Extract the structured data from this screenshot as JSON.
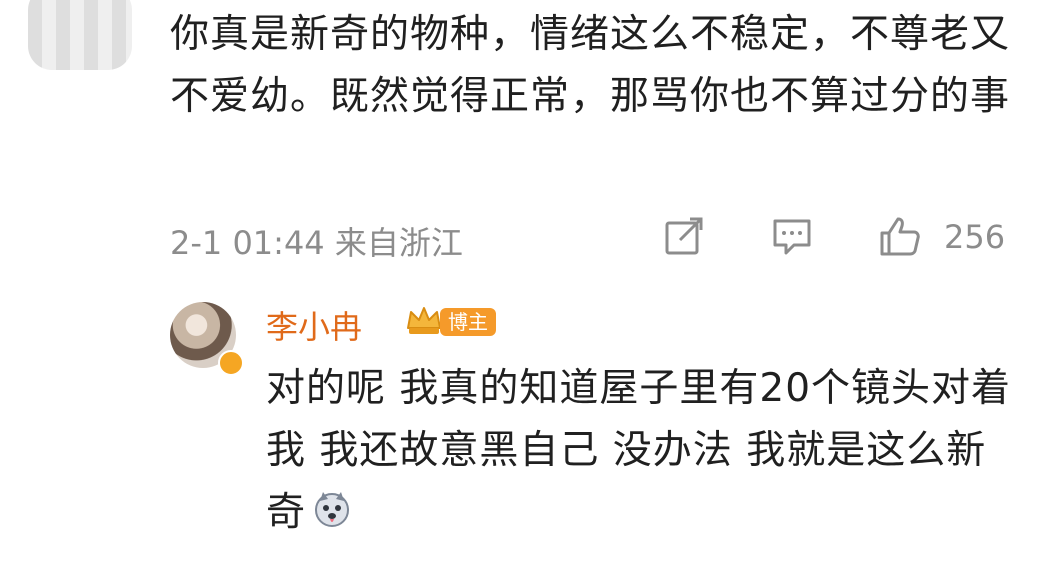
{
  "comment": {
    "text": "你真是新奇的物种，情绪这么不稳定，不尊老又不爱幼。既然觉得正常，那骂你也不算过分的事",
    "time_location": "2-1 01:44 来自浙江",
    "like_count": "256"
  },
  "reply": {
    "author": "李小冉",
    "badge": "博主",
    "text": "对的呢 我真的知道屋子里有20个镜头对着我 我还故意黑自己 没办法 我就是这么新奇",
    "emoji": "husky-dog-face-icon"
  },
  "colors": {
    "author": "#e06a1a",
    "badge_bg": "#f59a2a",
    "meta": "#8c8c8c"
  }
}
